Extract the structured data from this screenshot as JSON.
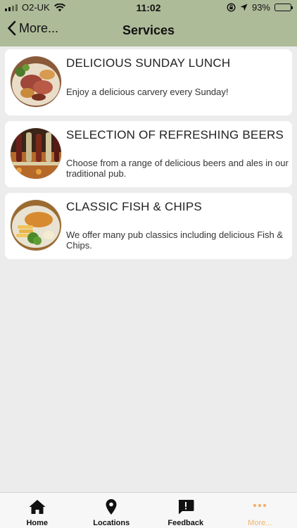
{
  "status_bar": {
    "carrier": "O2-UK",
    "time": "11:02",
    "battery": "93%",
    "battery_level": 0.93
  },
  "nav": {
    "back_label": "More...",
    "title": "Services"
  },
  "services": [
    {
      "title": "DELICIOUS SUNDAY LUNCH",
      "description": "Enjoy a delicious carvery every Sunday!",
      "image": "sunday-lunch-photo"
    },
    {
      "title": "SELECTION OF REFRESHING BEERS",
      "description": "Choose from a range of delicious beers and ales in our traditional pub.",
      "image": "beer-taps-photo"
    },
    {
      "title": "CLASSIC FISH & CHIPS",
      "description": "We offer many pub classics including delicious Fish & Chips.",
      "image": "fish-and-chips-photo"
    }
  ],
  "tabs": [
    {
      "label": "Home",
      "icon": "home-icon"
    },
    {
      "label": "Locations",
      "icon": "location-pin-icon"
    },
    {
      "label": "Feedback",
      "icon": "feedback-icon"
    },
    {
      "label": "More...",
      "icon": "more-dots-icon",
      "active": true
    }
  ],
  "colors": {
    "header_bg": "#aebb99",
    "page_bg": "#ececec",
    "active_tab": "#f0b36a",
    "battery_fill": "#f5c400"
  }
}
